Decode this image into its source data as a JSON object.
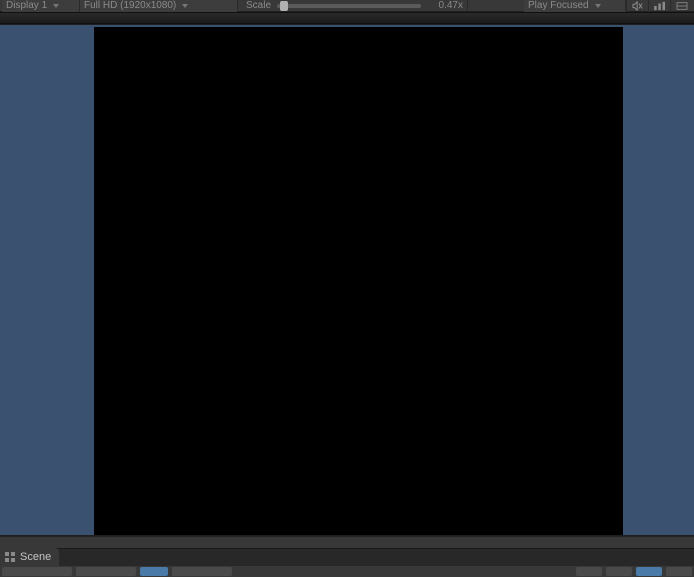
{
  "toolbar": {
    "display_label": "Display 1",
    "resolution_label": "Full HD (1920x1080)",
    "scale_label": "Scale",
    "scale_value": "0.47x",
    "play_mode_label": "Play Focused"
  },
  "tabs": {
    "scene_label": "Scene"
  },
  "colors": {
    "viewport_bg": "#3a5170",
    "render_bg": "#000000"
  }
}
